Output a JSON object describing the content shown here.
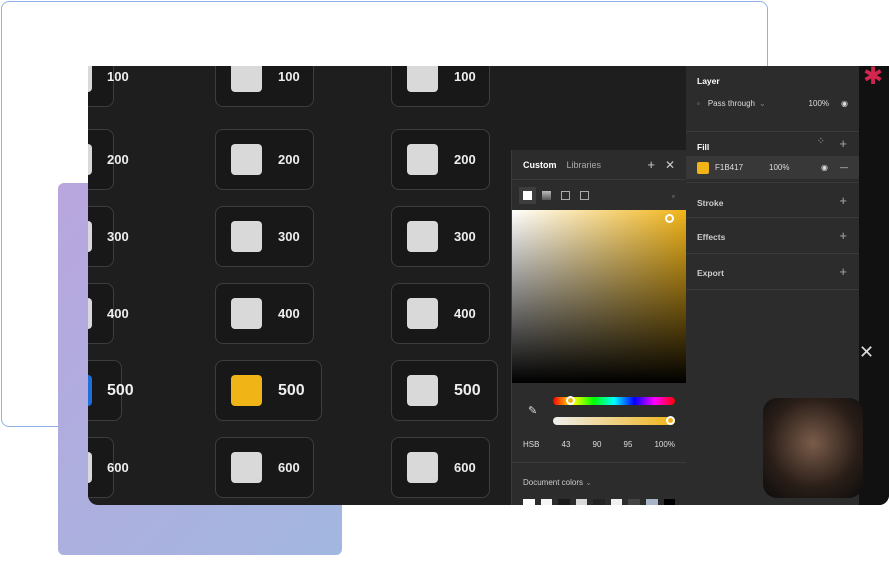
{
  "cards": {
    "rows": [
      "100",
      "200",
      "300",
      "400",
      "500",
      "600"
    ],
    "selected_row": "500",
    "selected_swatch_color": "#F1B417",
    "left_accent_color": "#1e6fd9"
  },
  "picker": {
    "tab_custom": "Custom",
    "tab_libraries": "Libraries",
    "mode": "HSB",
    "h": "43",
    "s": "90",
    "b": "95",
    "alpha": "100%",
    "doc_colors_label": "Document colors",
    "doc_colors": [
      "#ffffff",
      "#f5f5f5",
      "#1a1a1a",
      "#d9d9d9",
      "#222222",
      "#f0f0f0",
      "#444444",
      "#a9b5c6",
      "#000000"
    ]
  },
  "panel": {
    "layer_title": "Layer",
    "blend": "Pass through",
    "layer_opacity": "100%",
    "fill_title": "Fill",
    "fill_hex": "F1B417",
    "fill_opacity": "100%",
    "fill_color": "#F1B417",
    "stroke_title": "Stroke",
    "effects_title": "Effects",
    "export_title": "Export"
  }
}
